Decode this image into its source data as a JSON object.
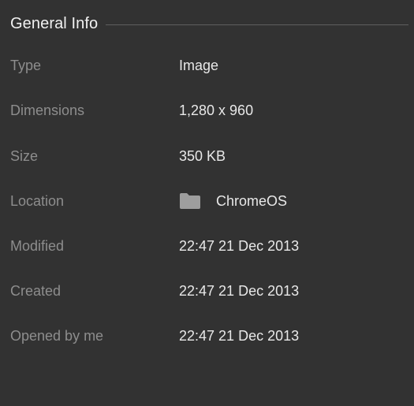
{
  "section": {
    "title": "General Info"
  },
  "rows": [
    {
      "label": "Type",
      "value": "Image"
    },
    {
      "label": "Dimensions",
      "value": "1,280 x 960"
    },
    {
      "label": "Size",
      "value": "350 KB"
    },
    {
      "label": "Location",
      "value": "ChromeOS",
      "icon": "folder-icon"
    },
    {
      "label": "Modified",
      "value": "22:47 21 Dec 2013"
    },
    {
      "label": "Created",
      "value": "22:47 21 Dec 2013"
    },
    {
      "label": "Opened by me",
      "value": "22:47 21 Dec 2013"
    }
  ],
  "colors": {
    "background": "#323232",
    "label": "#8d8d8d",
    "value": "#e8e8e8",
    "title": "#f1f1f1",
    "divider": "#5f5f5f",
    "folder_icon": "#9e9e9e"
  }
}
